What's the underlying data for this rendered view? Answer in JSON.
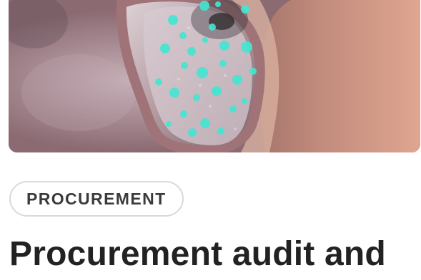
{
  "article_card": {
    "image": {
      "kind": "photo",
      "subject": "woman-wearing-glasses-reflection"
    },
    "category_label": "PROCUREMENT",
    "headline": "Procurement audit and"
  },
  "colors": {
    "text_dark": "#222222",
    "tag_border": "#d9d9d9",
    "tag_text": "#3a3a3a",
    "reflection_dots": "#43e6d2"
  }
}
